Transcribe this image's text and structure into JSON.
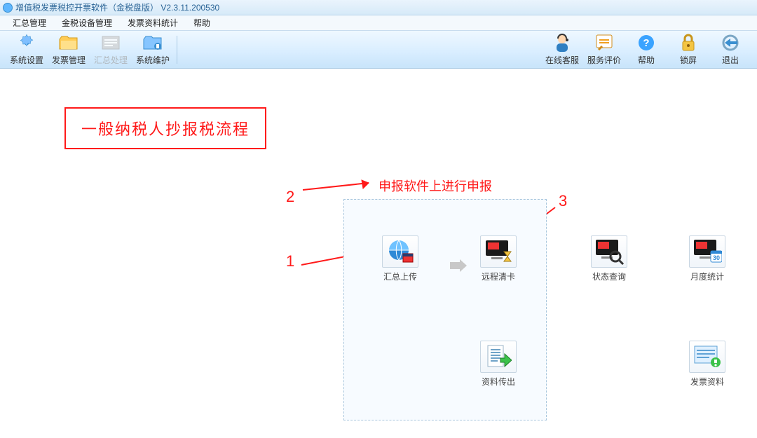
{
  "window": {
    "title": "增值税发票税控开票软件（金税盘版）  V2.3.11.200530"
  },
  "menubar": [
    {
      "label": "汇总管理"
    },
    {
      "label": "金税设备管理"
    },
    {
      "label": "发票资料统计"
    },
    {
      "label": "帮助"
    }
  ],
  "toolbar_left": [
    {
      "label": "系统设置",
      "icon": "settings-icon",
      "disabled": false
    },
    {
      "label": "发票管理",
      "icon": "folder-icon",
      "disabled": false
    },
    {
      "label": "汇总处理",
      "icon": "summary-icon",
      "disabled": true
    },
    {
      "label": "系统维护",
      "icon": "maint-icon",
      "disabled": false
    }
  ],
  "toolbar_right": [
    {
      "label": "在线客服",
      "icon": "agent-icon"
    },
    {
      "label": "服务评价",
      "icon": "rating-icon"
    },
    {
      "label": "帮助",
      "icon": "help-icon"
    },
    {
      "label": "锁屏",
      "icon": "lock-icon"
    },
    {
      "label": "退出",
      "icon": "exit-icon"
    }
  ],
  "annotations": {
    "title": "一般纳税人抄报税流程",
    "step1": "1",
    "step2": "2",
    "step3": "3",
    "note_declare": "申报软件上进行申报"
  },
  "panel_icons": {
    "upload": {
      "label": "汇总上传"
    },
    "remote": {
      "label": "远程清卡"
    },
    "export": {
      "label": "资料传出"
    }
  },
  "side_icons": {
    "status": {
      "label": "状态查询"
    },
    "monthly": {
      "label": "月度统计"
    },
    "invoice": {
      "label": "发票资料"
    }
  },
  "colors": {
    "accent_red": "#ff1a1a",
    "blue_dark": "#2a6496"
  }
}
